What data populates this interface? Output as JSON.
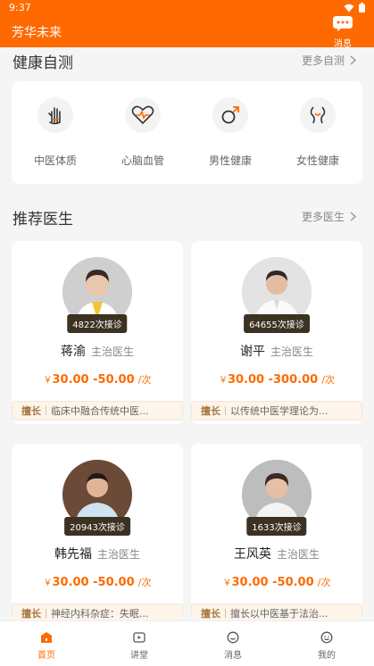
{
  "status_bar": {
    "time": "9:37"
  },
  "app_bar": {
    "title": "芳华未来",
    "message_label": "消息"
  },
  "self_test": {
    "title": "健康自测",
    "more": "更多自测",
    "items": [
      {
        "label": "中医体质",
        "icon": "palm-icon"
      },
      {
        "label": "心脑血管",
        "icon": "heart-pulse-icon"
      },
      {
        "label": "男性健康",
        "icon": "male-symbol-icon"
      },
      {
        "label": "女性健康",
        "icon": "female-icon"
      }
    ]
  },
  "doctors": {
    "title": "推荐医生",
    "more": "更多医生",
    "price_symbol": "￥",
    "price_unit": "/次",
    "skill_label": "擅长",
    "list": [
      {
        "consults": "4822次接诊",
        "name": "蒋渝",
        "title": "主治医生",
        "price": "30.00 -50.00",
        "skill": "临床中融合传统中医..."
      },
      {
        "consults": "64655次接诊",
        "name": "谢平",
        "title": "主治医生",
        "price": "30.00 -300.00",
        "skill": "以传统中医学理论为..."
      },
      {
        "consults": "20943次接诊",
        "name": "韩先福",
        "title": "主治医生",
        "price": "30.00 -50.00",
        "skill": "神经内科杂症：失眠..."
      },
      {
        "consults": "1633次接诊",
        "name": "王风英",
        "title": "主治医生",
        "price": "30.00 -50.00",
        "skill": "擅长以中医基于法治..."
      }
    ]
  },
  "tab_bar": {
    "items": [
      {
        "label": "首页",
        "icon": "home-icon",
        "active": true
      },
      {
        "label": "讲堂",
        "icon": "video-icon",
        "active": false
      },
      {
        "label": "消息",
        "icon": "message-icon",
        "active": false
      },
      {
        "label": "我的",
        "icon": "smile-icon",
        "active": false
      }
    ]
  },
  "colors": {
    "accent": "#ff6a00",
    "badge": "#3d3122",
    "skill_bg": "#fdf4ea"
  }
}
